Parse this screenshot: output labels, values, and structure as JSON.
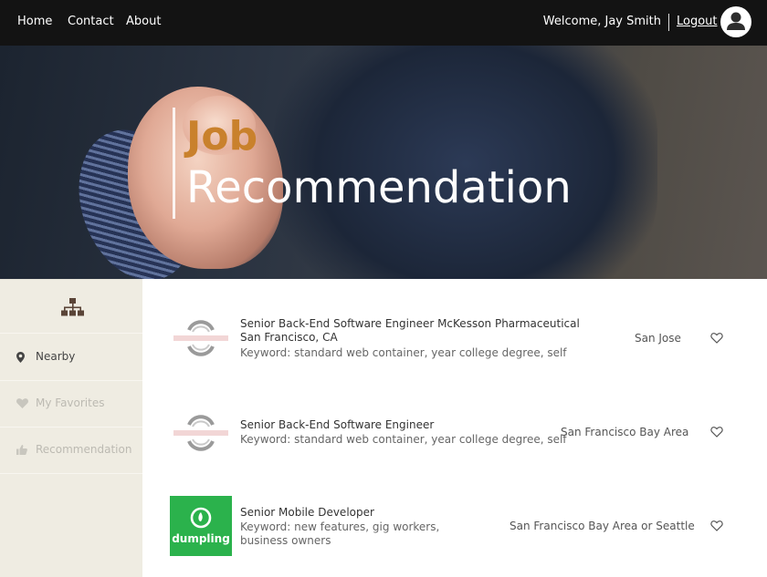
{
  "nav": {
    "home": "Home",
    "contact": "Contact",
    "about": "About",
    "welcome": "Welcome, Jay Smith",
    "logout": "Logout"
  },
  "hero": {
    "title_accent": "Job",
    "title_main": "Recommendation"
  },
  "sidebar": {
    "top_icon": "sitemap-icon",
    "items": [
      {
        "label": "Nearby",
        "icon": "map-marker-icon",
        "state": "active"
      },
      {
        "label": "My Favorites",
        "icon": "heart-icon",
        "state": "inactive"
      },
      {
        "label": "Recommendation",
        "icon": "thumbs-up-icon",
        "state": "inactive"
      }
    ]
  },
  "jobs": [
    {
      "title": "Senior Back-End Software Engineer McKesson Pharmaceutical San Francisco, CA",
      "keywords": "Keyword: standard web container, year college degree, self",
      "location": "San Jose",
      "logo": "circle-logo",
      "favorite": false
    },
    {
      "title": "Senior Back-End Software Engineer",
      "keywords": "Keyword: standard web container, year college degree, self",
      "location": "San Francisco Bay Area",
      "logo": "circle-logo",
      "favorite": false
    },
    {
      "title": "Senior Mobile Developer",
      "keywords": "Keyword: new features, gig workers, business owners",
      "location": "San Francisco Bay Area or Seattle",
      "logo": "dumpling-logo",
      "logo_text": "dumpling",
      "favorite": false
    }
  ],
  "colors": {
    "nav_bg": "#131313",
    "accent": "#c9812c",
    "sidebar_bg": "#efece2",
    "dumpling_green": "#2bb24c"
  }
}
